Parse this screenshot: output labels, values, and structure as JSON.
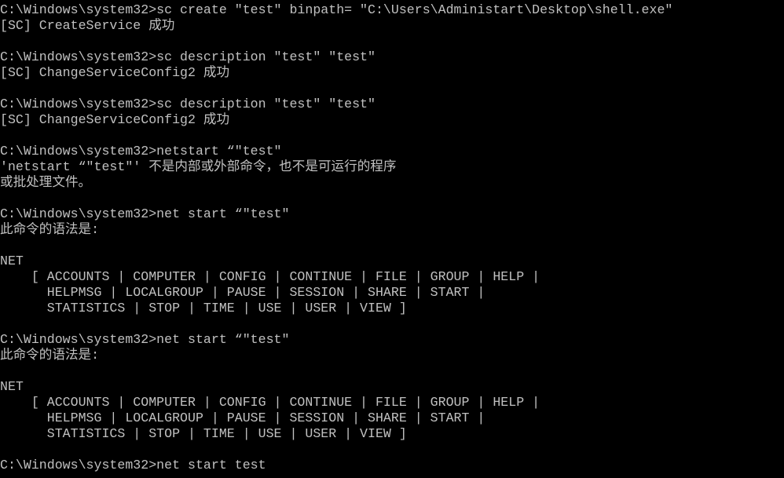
{
  "window": {
    "type": "command-prompt",
    "background": "#000000",
    "text_color": "#c0c0c0"
  },
  "lines": [
    "C:\\Windows\\system32>sc create ″test″ binpath= ″C:\\Users\\Administart\\Desktop\\shell.exe″",
    "[SC] CreateService 成功",
    "",
    "C:\\Windows\\system32>sc description ″test″ ″test″",
    "[SC] ChangeServiceConfig2 成功",
    "",
    "C:\\Windows\\system32>sc description ″test″ ″test″",
    "[SC] ChangeServiceConfig2 成功",
    "",
    "C:\\Windows\\system32>netstart “″test″",
    "′netstart “″test″′ 不是内部或外部命令，也不是可运行的程序",
    "或批处理文件。",
    "",
    "C:\\Windows\\system32>net start “″test″",
    "此命令的语法是:",
    "",
    "NET",
    "    [ ACCOUNTS | COMPUTER | CONFIG | CONTINUE | FILE | GROUP | HELP |",
    "      HELPMSG | LOCALGROUP | PAUSE | SESSION | SHARE | START |",
    "      STATISTICS | STOP | TIME | USE | USER | VIEW ]",
    "",
    "C:\\Windows\\system32>net start “″test″",
    "此命令的语法是:",
    "",
    "NET",
    "    [ ACCOUNTS | COMPUTER | CONFIG | CONTINUE | FILE | GROUP | HELP |",
    "      HELPMSG | LOCALGROUP | PAUSE | SESSION | SHARE | START |",
    "      STATISTICS | STOP | TIME | USE | USER | VIEW ]",
    "",
    "C:\\Windows\\system32>net start test"
  ]
}
